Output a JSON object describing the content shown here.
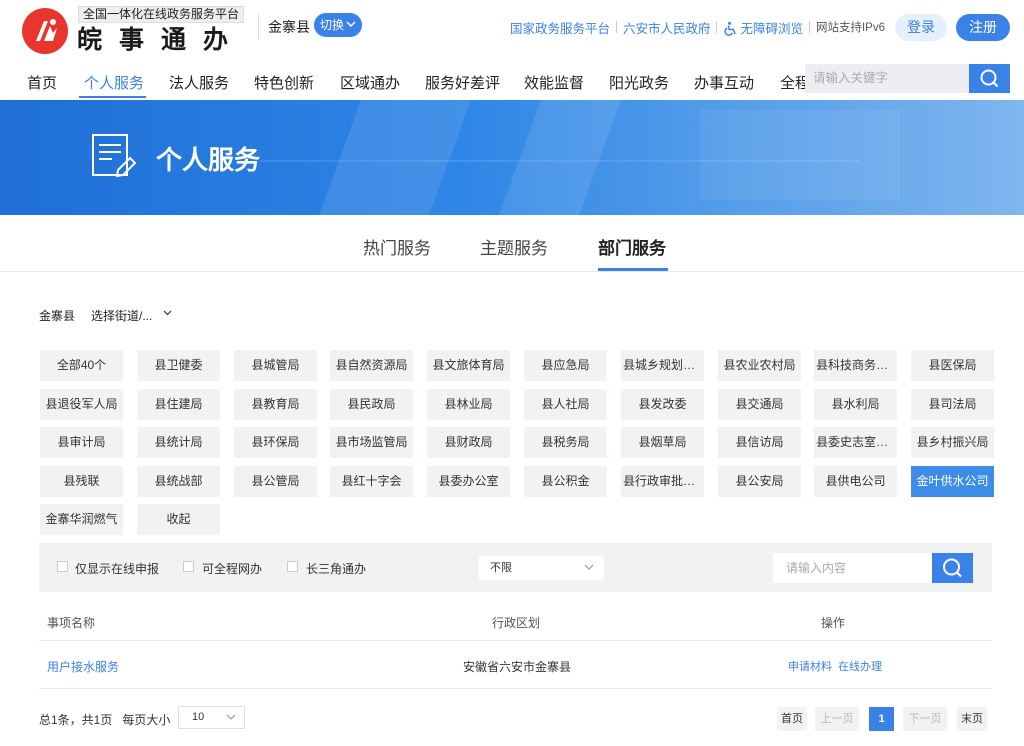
{
  "header": {
    "platform_tag": "全国一体化在线政务服务平台",
    "brand_name": "皖事通办",
    "county": "金寨县",
    "switch_label": "切换",
    "links": {
      "national": "国家政务服务平台",
      "city": "六安市人民政府",
      "accessible": "无障碍浏览",
      "ipv6": "网站支持IPv6"
    },
    "login_label": "登录",
    "register_label": "注册"
  },
  "nav": {
    "items": [
      "首页",
      "个人服务",
      "法人服务",
      "特色创新",
      "区域通办",
      "服务好差评",
      "效能监督",
      "阳光政务",
      "办事互动",
      "全程"
    ],
    "active_index": 1,
    "search_placeholder": "请输入关键字"
  },
  "banner": {
    "title": "个人服务"
  },
  "tabs": {
    "items": [
      "热门服务",
      "主题服务",
      "部门服务"
    ],
    "active_index": 2
  },
  "location": {
    "county": "金寨县",
    "street_select": "选择街道/..."
  },
  "departments": {
    "items": [
      "全部40个",
      "县卫健委",
      "县城管局",
      "县自然资源局",
      "县文旅体育局",
      "县应急局",
      "县城乡规划中心",
      "县农业农村局",
      "县科技商务经...",
      "县医保局",
      "县退役军人局",
      "县住建局",
      "县教育局",
      "县民政局",
      "县林业局",
      "县人社局",
      "县发改委",
      "县交通局",
      "县水利局",
      "县司法局",
      "县审计局",
      "县统计局",
      "县环保局",
      "县市场监管局",
      "县财政局",
      "县税务局",
      "县烟草局",
      "县信访局",
      "县委史志室（...",
      "县乡村振兴局",
      "县残联",
      "县统战部",
      "县公管局",
      "县红十字会",
      "县委办公室",
      "县公积金",
      "县行政审批局...",
      "县公安局",
      "县供电公司",
      "金叶供水公司",
      "金寨华润燃气",
      "收起"
    ],
    "active": "金叶供水公司"
  },
  "options": {
    "checkboxes": [
      "仅显示在线申报",
      "可全程网办",
      "长三角通办"
    ],
    "region_select": "不限",
    "search_placeholder": "请输入内容"
  },
  "table": {
    "headers": [
      "事项名称",
      "行政区划",
      "操作"
    ],
    "rows": [
      {
        "name": "用户接水服务",
        "region": "安徽省六安市金寨县",
        "actions": [
          "申请材料",
          "在线办理"
        ]
      }
    ]
  },
  "pagination": {
    "total_text": "总1条，共1页",
    "page_size_label": "每页大小",
    "page_size": "10",
    "first": "首页",
    "prev": "上一页",
    "current": "1",
    "next": "下一页",
    "last": "末页"
  },
  "colors": {
    "accent": "#3b82e8",
    "logo_red": "#e8362f",
    "active_dept": "#3d8de8"
  },
  "icons": {
    "logo": "wanshitong-logo",
    "search": "search-icon",
    "accessibility": "wheelchair-icon",
    "banner": "document-pen-icon"
  }
}
